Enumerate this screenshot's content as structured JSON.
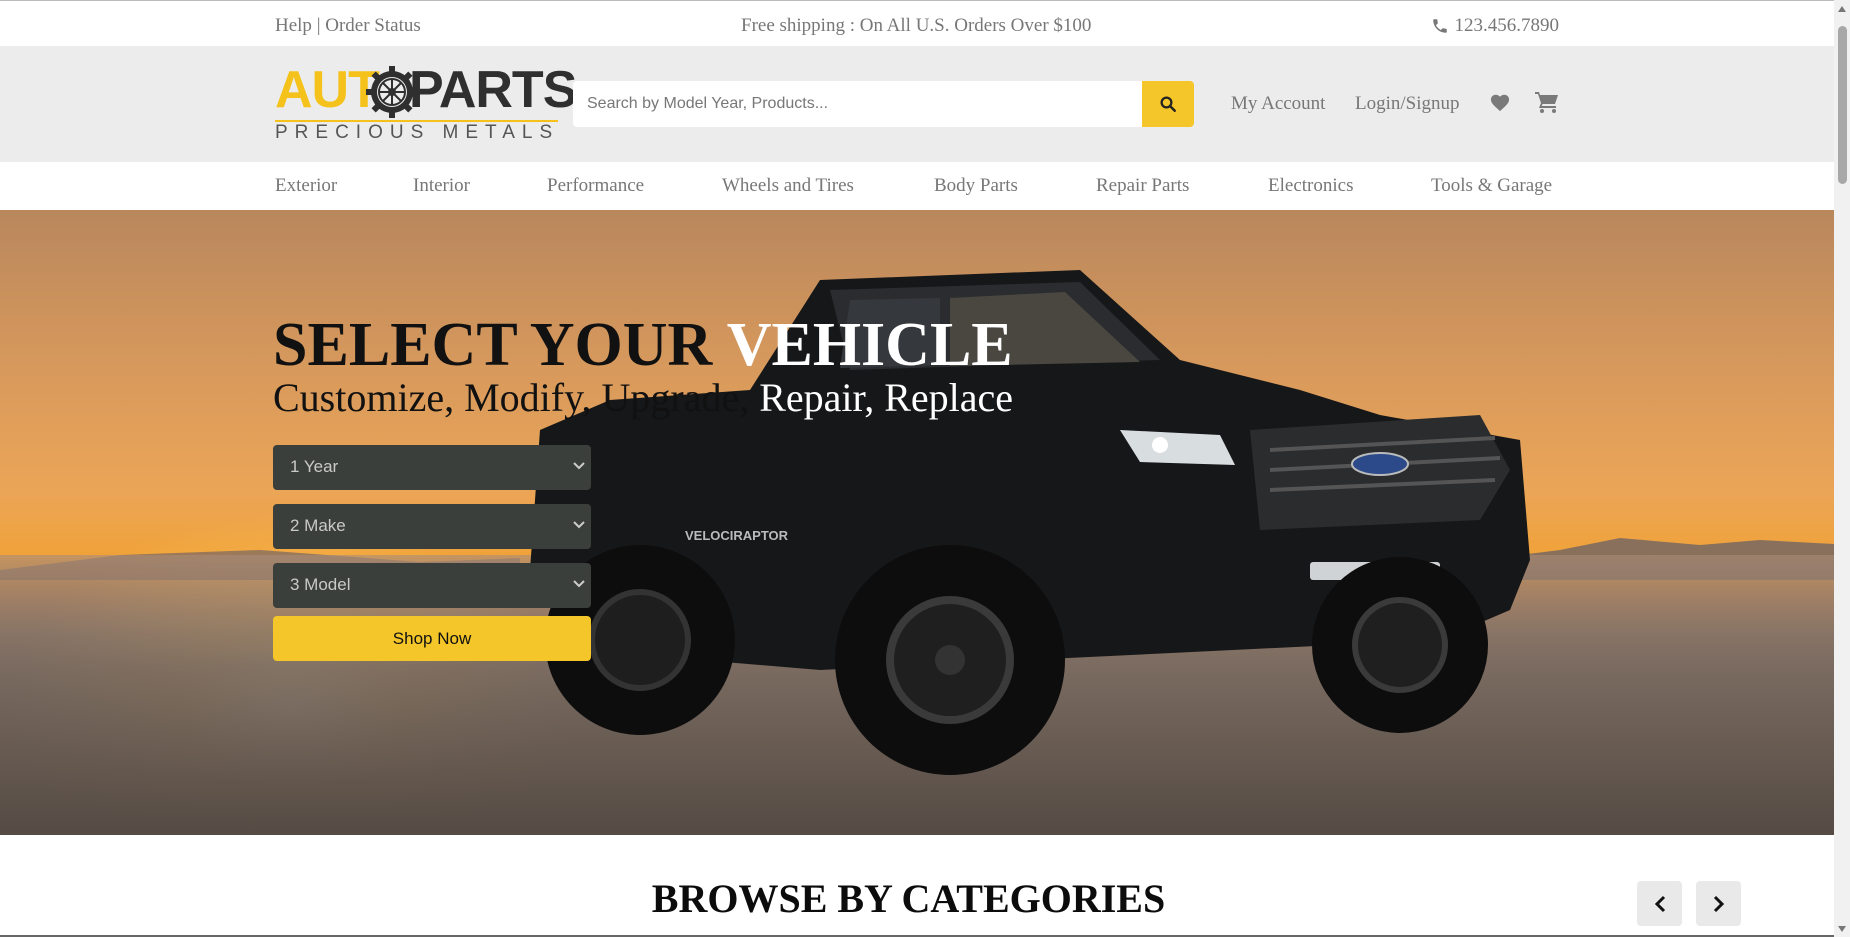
{
  "topbar": {
    "help": "Help",
    "separator": " | ",
    "order_status": "Order Status",
    "promo": "Free shipping : On All U.S. Orders Over $100",
    "phone": "123.456.7890"
  },
  "logo": {
    "word_left": "AUT",
    "word_right": "PARTS",
    "subtitle": "PRECIOUS METALS"
  },
  "search": {
    "placeholder": "Search by Model Year, Products..."
  },
  "header": {
    "account": "My Account",
    "login": "Login/Signup"
  },
  "nav": {
    "items": [
      "Exterior",
      "Interior",
      "Performance",
      "Wheels and Tires",
      "Body Parts",
      "Repair Parts",
      "Electronics",
      "Tools & Garage"
    ]
  },
  "hero": {
    "title_dark": "SELECT YOUR ",
    "title_light": "VEHICLE",
    "subtitle_dark": "Customize, Modify, Upgrade, ",
    "subtitle_light": "Repair, Replace",
    "select_year": "1 Year",
    "select_make": "2 Make",
    "select_model": "3 Model",
    "shop_button": "Shop Now",
    "truck_badge": "VELOCIRAPTOR"
  },
  "categories": {
    "title": "BROWSE BY CATEGORIES"
  },
  "colors": {
    "accent": "#f4c62a",
    "header_bg": "#ececec",
    "select_bg": "#3b3f3c"
  },
  "icons": {
    "phone": "phone-icon",
    "search": "search-icon",
    "heart": "heart-icon",
    "cart": "cart-icon",
    "dropdown": "chevron-down-icon",
    "prev": "chevron-left-icon",
    "next": "chevron-right-icon"
  }
}
